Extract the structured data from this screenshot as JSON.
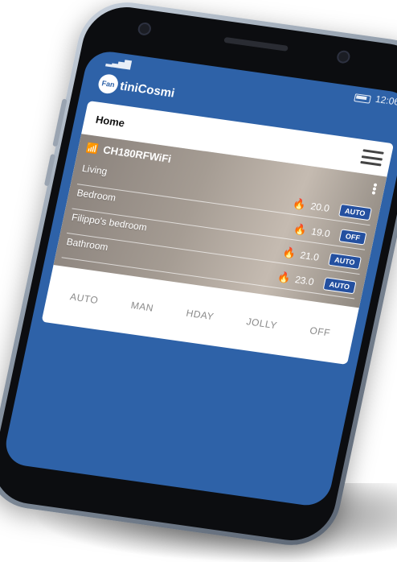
{
  "status_bar": {
    "signal": "▂▃▅▇",
    "time": "12:06"
  },
  "brand": {
    "logo_mark": "Fan",
    "logo_text": "tiniCosmi"
  },
  "header": {
    "title": "Home"
  },
  "device": {
    "name": "CH180RFWiFi",
    "wifi_icon": "wifi-icon"
  },
  "rooms": [
    {
      "name": "Living",
      "temp": "20.0",
      "mode": "AUTO"
    },
    {
      "name": "Bedroom",
      "temp": "19.0",
      "mode": "OFF"
    },
    {
      "name": "Filippo's bedroom",
      "temp": "21.0",
      "mode": "AUTO"
    },
    {
      "name": "Bathroom",
      "temp": "23.0",
      "mode": "AUTO"
    }
  ],
  "mode_tabs": [
    "AUTO",
    "MAN",
    "HDAY",
    "JOLLY",
    "OFF"
  ],
  "colors": {
    "screen_bg": "#2e62a8",
    "badge_bg": "#2450a0",
    "card_bg": "#ffffff"
  }
}
